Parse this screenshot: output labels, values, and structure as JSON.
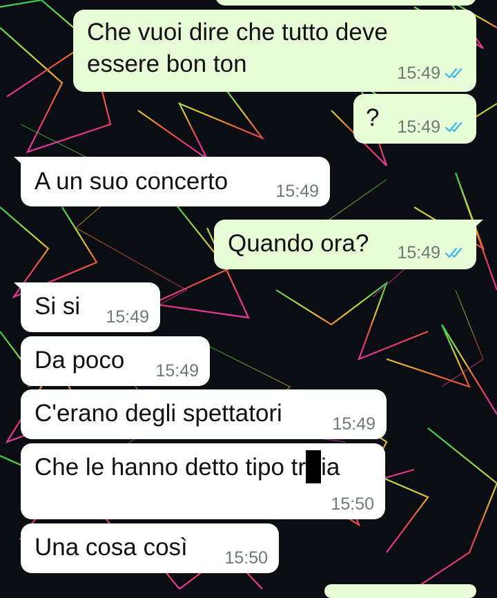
{
  "chat": {
    "messages": [
      {
        "dir": "sent",
        "text_line1": "Che vuoi dire che tutto deve",
        "text_line2": "essere bon ton",
        "time": "15:49",
        "status": "read-double-tick-icon"
      },
      {
        "dir": "sent",
        "text": "?",
        "time": "15:49",
        "status": "read-double-tick-icon"
      },
      {
        "dir": "received",
        "text": "A un suo concerto",
        "time": "15:49"
      },
      {
        "dir": "sent",
        "text": "Quando ora?",
        "time": "15:49",
        "status": "read-double-tick-icon"
      },
      {
        "dir": "received",
        "text": "Si si",
        "time": "15:49"
      },
      {
        "dir": "received",
        "text": "Da poco",
        "time": "15:49"
      },
      {
        "dir": "received",
        "text": "C'erano degli spettatori",
        "time": "15:49"
      },
      {
        "dir": "received",
        "text_before": "Che le hanno detto tipo tr",
        "text_after": "ia",
        "redacted": true,
        "time": "15:50"
      },
      {
        "dir": "received",
        "text": "Una cosa così",
        "time": "15:50"
      }
    ]
  },
  "colors": {
    "sent_bubble": "#e7fbd7",
    "received_bubble": "#ffffff",
    "read_tick": "#34b7f1",
    "time_text": "#6f7a73",
    "wallpaper_base": "#0a0d12"
  },
  "wallpaper": "neon geometric polygons (green, yellow, orange, red, pink)"
}
